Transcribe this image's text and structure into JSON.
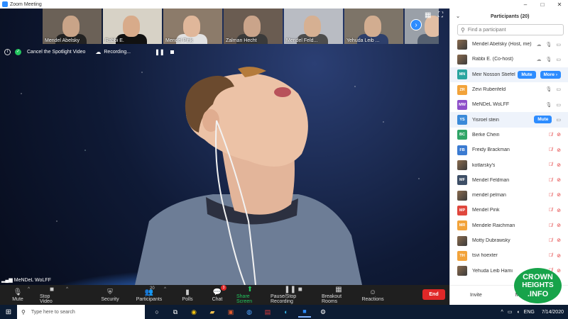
{
  "window": {
    "title": "Zoom Meeting",
    "controls": [
      "–",
      "□",
      "✕"
    ]
  },
  "thumbnails": [
    {
      "name": "Mendel Abelsky",
      "bg": "#6b6157",
      "face": "#c9a488",
      "body": "#222222"
    },
    {
      "name": "Rabbi E.",
      "bg": "#d7d2c6",
      "face": "#d8ab8a",
      "body": "#111111"
    },
    {
      "name": "Mendel Pink",
      "bg": "#8c7b6a",
      "face": "#e0b79a",
      "body": "#e2e2e2"
    },
    {
      "name": "Zalman Hecht",
      "bg": "#6a5c51",
      "face": "#caa48a",
      "body": "#3a3a3a"
    },
    {
      "name": "Mendel Feld...",
      "bg": "#b9bcc3",
      "face": "#d6b092",
      "body": "#4d4d4d"
    },
    {
      "name": "Yehuda Leib ...",
      "bg": "#7d7468",
      "face": "#d2ad90",
      "body": "#2d3f6b"
    },
    {
      "name": "",
      "bg": "#9aa0a8",
      "face": "#e1bea4",
      "body": "#556070"
    }
  ],
  "spotlight_bar": {
    "cancel_label": "Cancel the Spotlight Video",
    "recording_label": "Recording..."
  },
  "active_speaker": {
    "name": "MeNDeL WoLFF"
  },
  "toolbar": {
    "mute": "Mute",
    "stop_video": "Stop Video",
    "security": "Security",
    "participants": "Participants",
    "participants_count": "20",
    "polls": "Polls",
    "chat": "Chat",
    "chat_badge": "3",
    "share_screen": "Share Screen",
    "recording": "Pause/Stop Recording",
    "breakout": "Breakout Rooms",
    "reactions": "Reactions",
    "end": "End"
  },
  "participants_panel": {
    "title": "Participants (20)",
    "search_placeholder": "Find a participant",
    "invite": "Invite",
    "mute_all": "Mute",
    "mute_btn": "Mute",
    "more_btn": "More ›",
    "rows": [
      {
        "initials": "",
        "name": "Mendel Abelsky (Host, me)",
        "color": "",
        "photo": true,
        "mic": "on",
        "cam": "on",
        "cloud": true
      },
      {
        "initials": "",
        "name": "Rabbi E. (Co-host)",
        "color": "",
        "photo": true,
        "mic": "on",
        "cam": "on",
        "cloud": true
      },
      {
        "initials": "MN",
        "name": "Meir Nosson Stiefel",
        "color": "#2aa5a0",
        "photo": false,
        "mic": "none",
        "cam": "none",
        "buttons": [
          "mute",
          "more"
        ],
        "hl": true
      },
      {
        "initials": "ZR",
        "name": "Zevi Rubenfeld",
        "color": "#f2a33a",
        "photo": false,
        "mic": "on",
        "cam": "on"
      },
      {
        "initials": "MW",
        "name": "MeNDeL WoLFF",
        "color": "#8e4fc9",
        "photo": false,
        "mic": "on",
        "cam": "on"
      },
      {
        "initials": "YS",
        "name": "Yisroel stein",
        "color": "#3b8ad9",
        "photo": false,
        "mic": "none",
        "cam": "on",
        "buttons": [
          "mute"
        ],
        "hl": true
      },
      {
        "initials": "BC",
        "name": "Berke Chein",
        "color": "#2fa567",
        "photo": false,
        "mic": "off",
        "cam": "off"
      },
      {
        "initials": "FB",
        "name": "Freidy Brackman",
        "color": "#3b7bd1",
        "photo": false,
        "mic": "off",
        "cam": "off"
      },
      {
        "initials": "",
        "name": "kotlarsky's",
        "color": "",
        "photo": true,
        "mic": "off",
        "cam": "off"
      },
      {
        "initials": "MF",
        "name": "Mendel Feldman",
        "color": "#3e4f66",
        "photo": false,
        "mic": "off",
        "cam": "off"
      },
      {
        "initials": "",
        "name": "mendel pelman",
        "color": "",
        "photo": true,
        "mic": "off",
        "cam": "off"
      },
      {
        "initials": "MP",
        "name": "Mendel Pink",
        "color": "#e0473d",
        "photo": false,
        "mic": "off",
        "cam": "off"
      },
      {
        "initials": "MR",
        "name": "Mendele Raichman",
        "color": "#f2a33a",
        "photo": false,
        "mic": "off",
        "cam": "off"
      },
      {
        "initials": "",
        "name": "Motty Dubrawsky",
        "color": "",
        "photo": true,
        "mic": "off",
        "cam": "off"
      },
      {
        "initials": "TH",
        "name": "tsvi hoexter",
        "color": "#f2a33a",
        "photo": false,
        "mic": "off",
        "cam": "off"
      },
      {
        "initials": "",
        "name": "Yehuda Leib Hami",
        "color": "",
        "photo": true,
        "mic": "off",
        "cam": "off"
      }
    ]
  },
  "watermark": {
    "line1": "CROWN",
    "line2": "HEIGHTS",
    "line3": ".INFO"
  },
  "taskbar": {
    "search_placeholder": "Type here to search",
    "lang": "ENG",
    "date": "7/14/2020"
  }
}
